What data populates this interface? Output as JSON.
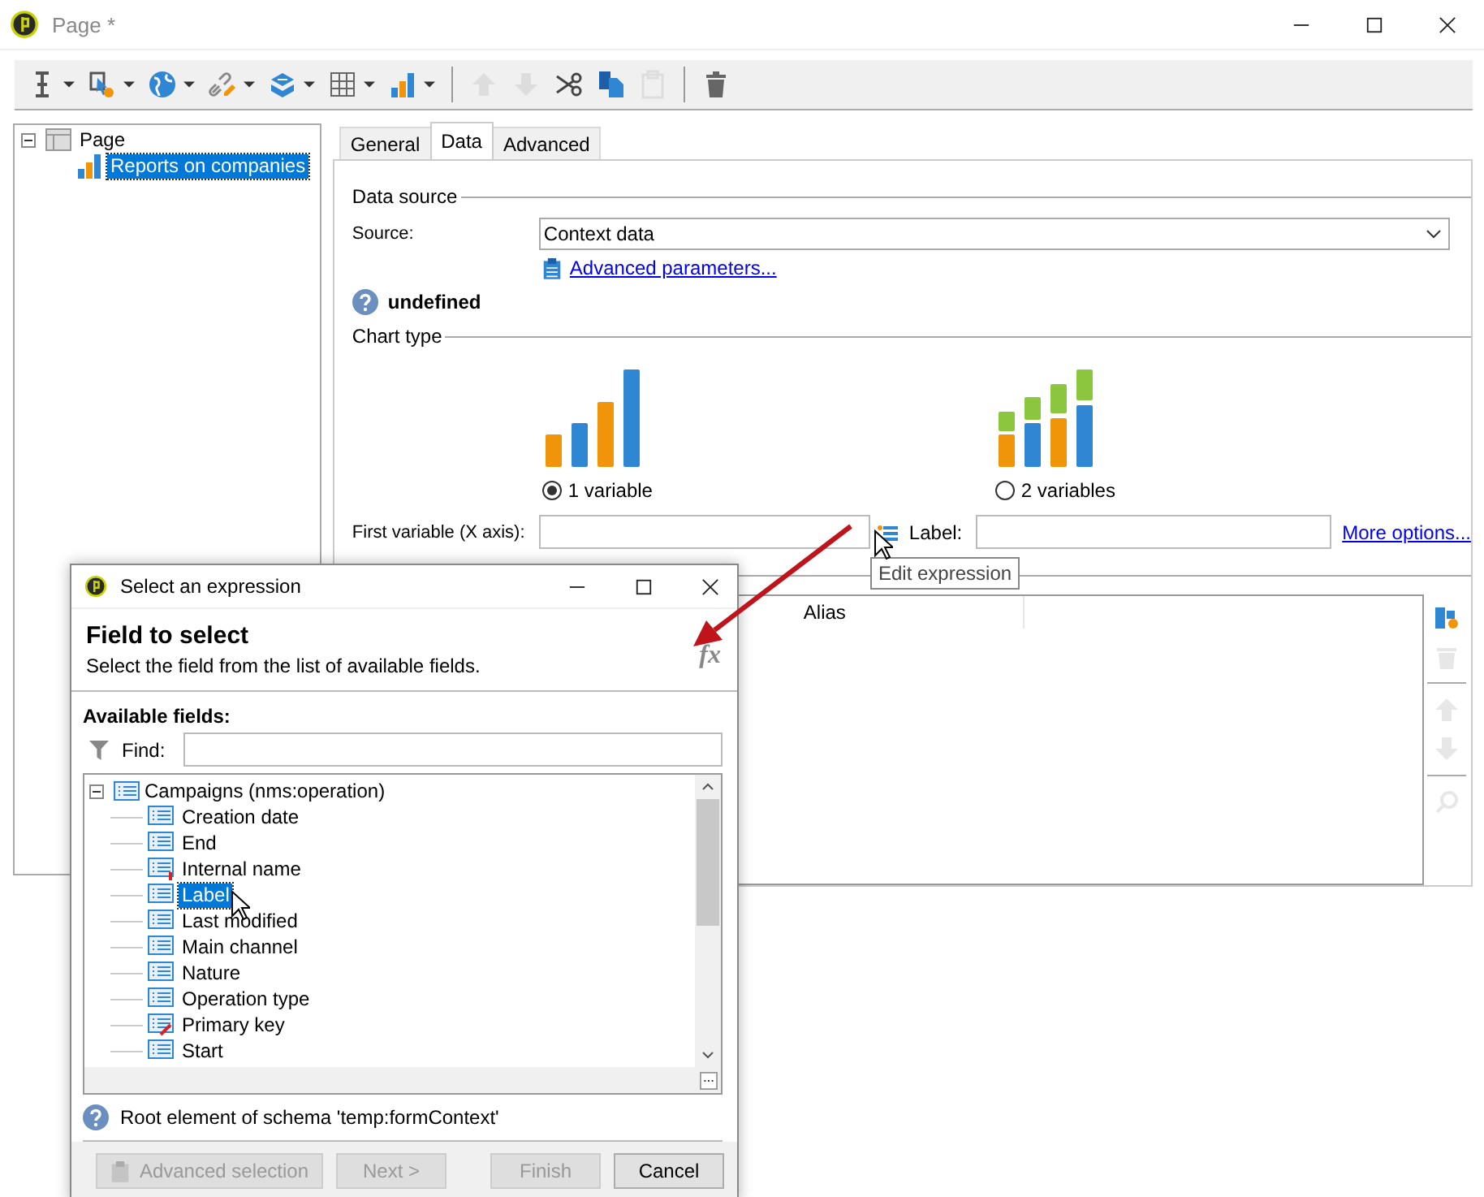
{
  "window": {
    "title": "Page *"
  },
  "toolbar": [
    {
      "kind": "text-cursor",
      "dropdown": true,
      "disabled": false
    },
    {
      "kind": "pointer",
      "dropdown": true,
      "disabled": false
    },
    {
      "kind": "globe",
      "dropdown": true,
      "disabled": false
    },
    {
      "kind": "link",
      "dropdown": true,
      "disabled": false
    },
    {
      "kind": "layers",
      "dropdown": true,
      "disabled": false
    },
    {
      "kind": "grid",
      "dropdown": true,
      "disabled": false
    },
    {
      "kind": "chart",
      "dropdown": true,
      "disabled": false
    },
    {
      "kind": "separator"
    },
    {
      "kind": "up",
      "dropdown": false,
      "disabled": true
    },
    {
      "kind": "down",
      "dropdown": false,
      "disabled": true
    },
    {
      "kind": "cut",
      "dropdown": false,
      "disabled": false
    },
    {
      "kind": "copy",
      "dropdown": false,
      "disabled": false
    },
    {
      "kind": "paste",
      "dropdown": false,
      "disabled": true
    },
    {
      "kind": "separator"
    },
    {
      "kind": "delete",
      "dropdown": false,
      "disabled": false
    }
  ],
  "tree": [
    {
      "label": "Page",
      "expanded": true,
      "selected": false,
      "children": [
        {
          "label": "Reports on companies",
          "selected": true
        }
      ]
    }
  ],
  "tabs": [
    {
      "label": "General",
      "selected": false
    },
    {
      "label": "Data",
      "selected": true
    },
    {
      "label": "Advanced",
      "selected": false
    }
  ],
  "data_source": {
    "heading": "Data source",
    "source_label": "Source:",
    "source_value": "Context data",
    "link": "Advanced parameters..."
  },
  "info": "undefined",
  "chart_type": {
    "heading": "Chart type",
    "options": [
      {
        "kind": "single",
        "label": "1 variable",
        "selected": true
      },
      {
        "kind": "double",
        "label": "2 variables",
        "selected": false
      }
    ]
  },
  "first_variable": {
    "label": "First variable (X axis):",
    "label_field": "Label:",
    "link": "More options..."
  },
  "tooltip": "Edit expression",
  "series_table": {
    "columns": [
      "Alias"
    ]
  },
  "side_tools": [
    {
      "kind": "add",
      "disabled": false
    },
    {
      "kind": "delete",
      "disabled": true
    },
    {
      "kind": "separator"
    },
    {
      "kind": "up",
      "disabled": true
    },
    {
      "kind": "down",
      "disabled": true
    },
    {
      "kind": "separator"
    },
    {
      "kind": "search",
      "disabled": true
    }
  ],
  "dialog": {
    "title": "Select an expression",
    "heading": "Field to select",
    "description": "Select the field from the list of available fields.",
    "formula_icon": "fx",
    "fields_label": "Available fields:",
    "find_label": "Find:",
    "tree": {
      "label": "Campaigns (nms:operation)",
      "expanded": true,
      "children": [
        {
          "label": "Creation date",
          "kind": "field",
          "selected": false
        },
        {
          "label": "End",
          "kind": "field",
          "selected": false
        },
        {
          "label": "Internal name",
          "kind": "mandatory",
          "selected": false
        },
        {
          "label": "Label",
          "kind": "field",
          "selected": true
        },
        {
          "label": "Last modified",
          "kind": "field",
          "selected": false
        },
        {
          "label": "Main channel",
          "kind": "field",
          "selected": false
        },
        {
          "label": "Nature",
          "kind": "field",
          "selected": false
        },
        {
          "label": "Operation type",
          "kind": "field",
          "selected": false
        },
        {
          "label": "Primary key",
          "kind": "key",
          "selected": false
        },
        {
          "label": "Start",
          "kind": "field",
          "selected": false
        }
      ]
    },
    "status": "Root element of schema 'temp:formContext'",
    "buttons": [
      {
        "label": "Advanced selection",
        "disabled": true,
        "icon": true
      },
      {
        "label": "Next >",
        "disabled": true,
        "icon": false
      },
      {
        "label": "Finish",
        "disabled": true,
        "icon": false
      },
      {
        "label": "Cancel",
        "disabled": false,
        "icon": false
      }
    ]
  }
}
